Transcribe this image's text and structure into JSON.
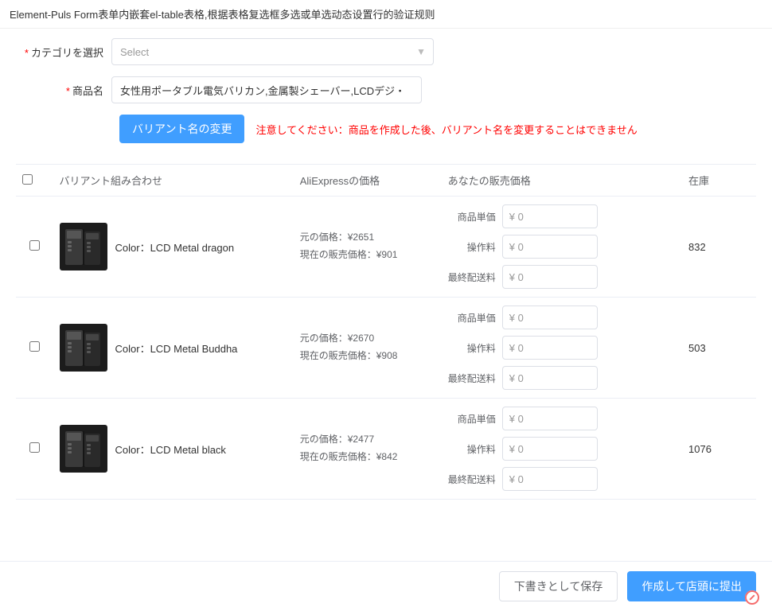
{
  "page": {
    "title": "Element-Puls Form表单内嵌套el-table表格,根据表格复选框多选或单选动态设置行的验证规则"
  },
  "form": {
    "category_label": "カテゴリを選択",
    "category_placeholder": "Select",
    "category_required": true,
    "product_name_label": "商品名",
    "product_name_value": "女性用ポータブル電気バリカン,金属製シェーバー,LCDデジ・",
    "product_name_required": true
  },
  "variant_section": {
    "change_button_label": "バリアント名の変更",
    "warning_prefix": "注意してください：",
    "warning_text": "商品を作成した後、バリアント名を変更することはできません"
  },
  "table": {
    "headers": {
      "checkbox": "",
      "variant": "バリアント組み合わせ",
      "ali_price": "AliExpressの価格",
      "your_price": "あなたの販売価格",
      "stock": "在庫"
    },
    "price_labels": {
      "unit": "商品単価",
      "handling": "操作料",
      "shipping": "最終配送料"
    },
    "rows": [
      {
        "id": 1,
        "variant_name": "Color：LCD Metal dragon",
        "original_price": "元の価格：¥2651",
        "current_price": "現在の販売価格：¥901",
        "unit_price": "¥ 0",
        "handling_fee": "¥ 0",
        "shipping_fee": "¥ 0",
        "stock": "832"
      },
      {
        "id": 2,
        "variant_name": "Color：LCD Metal Buddha",
        "original_price": "元の価格：¥2670",
        "current_price": "現在の販売価格：¥908",
        "unit_price": "¥ 0",
        "handling_fee": "¥ 0",
        "shipping_fee": "¥ 0",
        "stock": "503"
      },
      {
        "id": 3,
        "variant_name": "Color：LCD Metal black",
        "original_price": "元の価格：¥2477",
        "current_price": "現在の販売価格：¥842",
        "unit_price": "¥ 0",
        "handling_fee": "¥ 0",
        "shipping_fee": "¥ 0",
        "stock": "1076"
      }
    ]
  },
  "footer": {
    "save_draft_label": "下書きとして保存",
    "submit_label": "作成して店頭に提出"
  }
}
